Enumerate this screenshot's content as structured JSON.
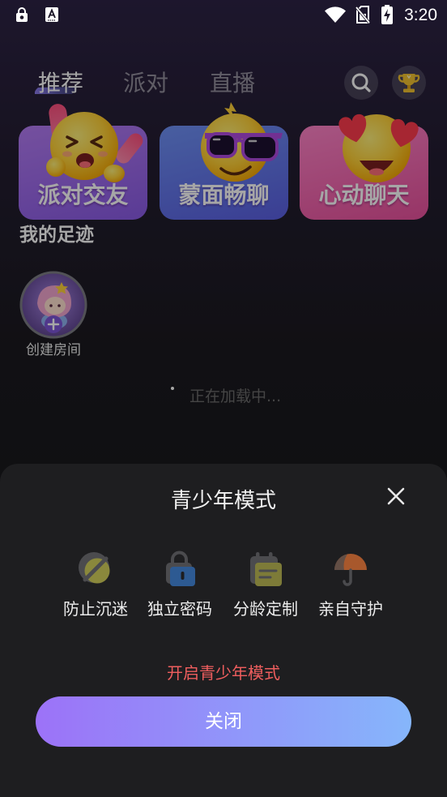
{
  "status_bar": {
    "time": "3:20",
    "left_icons": [
      "lock-notification-icon",
      "keyboard-a-notification-icon"
    ],
    "right_icons": [
      "wifi-icon",
      "no-sim-icon",
      "battery-charging-icon"
    ]
  },
  "top_nav": {
    "tabs": [
      {
        "label": "推荐",
        "selected": true
      },
      {
        "label": "派对",
        "selected": false
      },
      {
        "label": "直播",
        "selected": false
      }
    ],
    "actions": [
      "search-icon",
      "trophy-icon"
    ]
  },
  "quick_entries": [
    {
      "label": "派对交友",
      "emoji": "shouting-face-emoji",
      "gradient": [
        "#b47cf4",
        "#8a5be6"
      ]
    },
    {
      "label": "蒙面畅聊",
      "emoji": "sunglasses-face-emoji",
      "gradient": [
        "#6f92f6",
        "#5a5fe2"
      ]
    },
    {
      "label": "心动聊天",
      "emoji": "heart-eyes-face-emoji",
      "gradient": [
        "#ff84c8",
        "#e9519d"
      ]
    }
  ],
  "footprint": {
    "title": "我的足迹",
    "create_room": {
      "label": "创建房间",
      "icon": "add-room-avatar",
      "badge_icon": "plus-icon"
    }
  },
  "loading": {
    "text": "正在加载中..."
  },
  "youth_mode_dialog": {
    "title": "青少年模式",
    "close_icon": "close-icon",
    "features": [
      {
        "label": "防止沉迷",
        "icon": "anti-addiction-icon"
      },
      {
        "label": "独立密码",
        "icon": "lock-icon"
      },
      {
        "label": "分龄定制",
        "icon": "calendar-icon"
      },
      {
        "label": "亲自守护",
        "icon": "umbrella-icon"
      }
    ],
    "enable_link": "开启青少年模式",
    "close_button": "关闭"
  },
  "colors": {
    "link": "#ef5e5e",
    "button_gradient_start": "#9c72f8",
    "button_gradient_end": "#86b6fb",
    "sheet_background": "#1e1e20",
    "backdrop": "rgba(0,0,0,0.35)",
    "tab_indicator": "#8d7cf0"
  }
}
